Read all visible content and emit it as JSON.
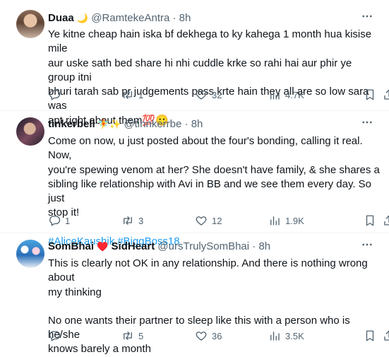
{
  "tweets": [
    {
      "name": "Duaa",
      "name_emoji": "🌙",
      "handle": "@RamtekeAntra",
      "separator": "·",
      "time": "8h",
      "lines": [
        "Ye kitne cheap hain iska bf dekhega to ky kahega 1 month hua kisise mile",
        "aur uske sath  bed share hi nhi cuddle krke so rahi hai aur phir ye group itni",
        "bhuri tarah sab pr judgements pass krte hain they all are so low sara was",
        "apt right about them💯😶"
      ],
      "stats": {
        "replies": "",
        "reposts": "1",
        "likes": "32",
        "views": "4.7K"
      }
    },
    {
      "name": "tinkerbell",
      "name_emoji": "🧚✨",
      "handle": "@tinnkerrbe",
      "separator": "·",
      "time": "8h",
      "lines": [
        "Come on now, u just posted about the four's bonding, calling it real. Now,",
        "you're spewing venom at her? She doesn't have family, & she shares a",
        "sibling like relationship with Avi in BB and we see them every day. So just",
        "stop it!"
      ],
      "hashtags": [
        "#AliceKaushik",
        "#BiggBoss18"
      ],
      "stats": {
        "replies": "1",
        "reposts": "3",
        "likes": "12",
        "views": "1.9K"
      }
    },
    {
      "name": "SomBhai",
      "name_emoji": "♥️",
      "name2": "SidHeart",
      "handle": "@ursTrulySomBhai",
      "separator": "·",
      "time": "8h",
      "lines": [
        "This is clearly not OK in any relationship. And there is nothing wrong about",
        "my thinking"
      ],
      "lines2": [
        "No one wants their partner to sleep like this with a person who is he/she",
        "knows barely a month"
      ],
      "stats": {
        "replies": "",
        "reposts": "5",
        "likes": "36",
        "views": "3.5K"
      }
    }
  ],
  "icons": [
    "more-icon",
    "reply-icon",
    "repost-icon",
    "like-icon",
    "views-icon",
    "bookmark-icon",
    "share-icon"
  ],
  "colors": {
    "text": "#0f1419",
    "secondary": "#536471",
    "link": "#1d9bf0",
    "divider": "#eff3f4"
  }
}
